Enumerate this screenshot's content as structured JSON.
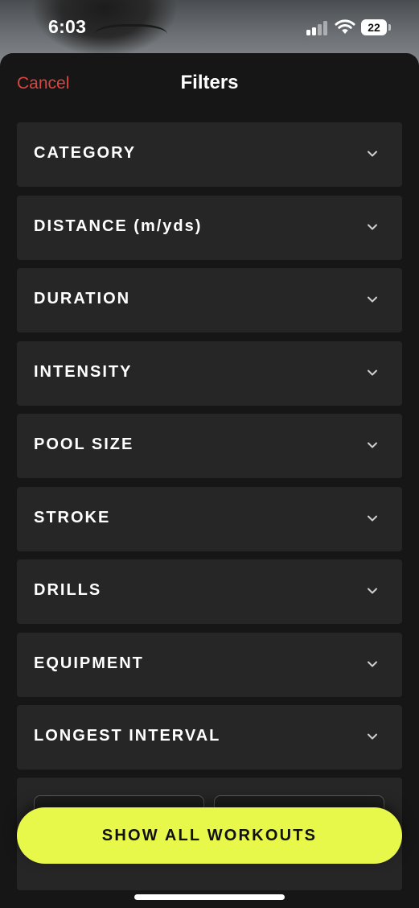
{
  "status_bar": {
    "time": "6:03",
    "battery": "22"
  },
  "header": {
    "cancel_label": "Cancel",
    "title": "Filters"
  },
  "filters": [
    {
      "label": "CATEGORY"
    },
    {
      "label": "DISTANCE (m/yds)"
    },
    {
      "label": "DURATION"
    },
    {
      "label": "INTENSITY"
    },
    {
      "label": "POOL SIZE"
    },
    {
      "label": "STROKE"
    },
    {
      "label": "DRILLS"
    },
    {
      "label": "EQUIPMENT"
    },
    {
      "label": "LONGEST INTERVAL"
    }
  ],
  "cta": {
    "label": "SHOW ALL WORKOUTS"
  },
  "colors": {
    "accent": "#e8f84a",
    "cancel": "#d9453f",
    "row_bg": "#262626",
    "sheet_bg": "#161616"
  },
  "icons": {
    "chevron": "chevron-down-icon",
    "signal": "cellular-signal-icon",
    "wifi": "wifi-icon",
    "battery": "battery-icon"
  }
}
